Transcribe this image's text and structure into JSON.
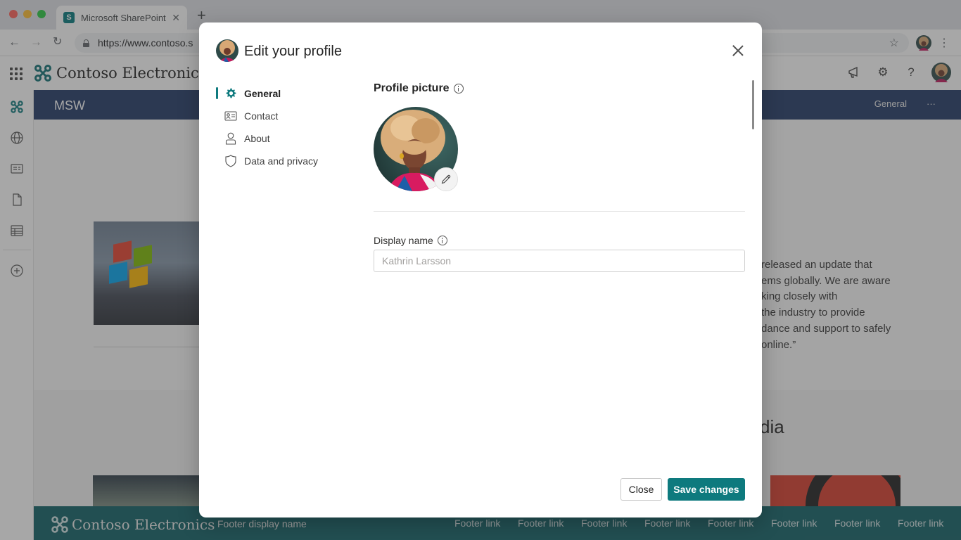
{
  "browser": {
    "tab_title": "Microsoft SharePoint",
    "tab_favicon_letter": "S",
    "url": "https://www.contoso.s"
  },
  "suite": {
    "brand": "Contoso Electronics",
    "icons": [
      "megaphone-icon",
      "gear-icon",
      "help-icon",
      "avatar"
    ]
  },
  "site": {
    "title": "MSW",
    "nav_general": "General",
    "nav_more": "···"
  },
  "page": {
    "quote_lines": [
      "released an update that",
      "ems globally. We are aware",
      "king closely with",
      "the industry to provide",
      "dance and support to safely",
      " online.”"
    ],
    "media_heading": "dia"
  },
  "footer": {
    "brand": "Contoso Electronics",
    "display_name": "Footer display name",
    "links": [
      "Footer link",
      "Footer link",
      "Footer link",
      "Footer link",
      "Footer link",
      "Footer link",
      "Footer link",
      "Footer link"
    ]
  },
  "modal": {
    "title": "Edit your profile",
    "nav": [
      {
        "label": "General",
        "icon": "gear-icon",
        "active": true
      },
      {
        "label": "Contact",
        "icon": "contact-card-icon",
        "active": false
      },
      {
        "label": "About",
        "icon": "person-icon",
        "active": false
      },
      {
        "label": "Data and privacy",
        "icon": "shield-icon",
        "active": false
      }
    ],
    "profile_picture_label": "Profile picture",
    "display_name_label": "Display name",
    "display_name_placeholder": "Kathrin Larsson",
    "close_button": "Close",
    "save_button": "Save changes"
  },
  "colors": {
    "accent": "#0e7a7e",
    "site_bar": "#203864",
    "footer": "#0e5f64"
  }
}
